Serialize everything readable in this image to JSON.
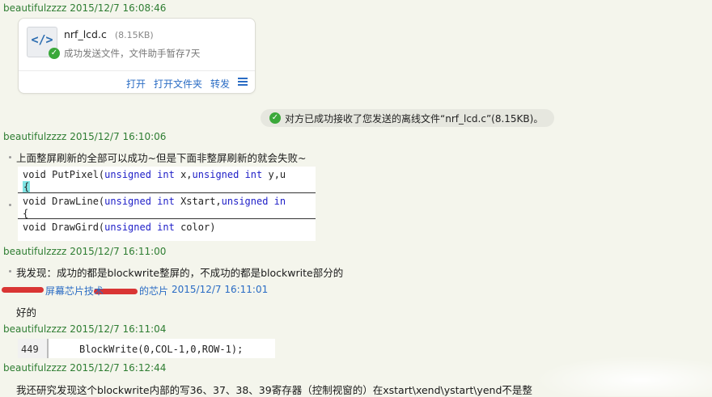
{
  "messages": {
    "m1": {
      "sender": "beautifulzzzz",
      "time": "2015/12/7 16:08:46"
    },
    "m2": {
      "sender": "beautifulzzzz",
      "time": "2015/12/7 16:10:06",
      "text": "上面整屏刷新的全部可以成功~但是下面非整屏刷新的就会失败~"
    },
    "m3": {
      "sender": "beautifulzzzz",
      "time": "2015/12/7 16:11:00",
      "text": "我发现：成功的都是blockwrite整屏的，不成功的都是blockwrite部分的"
    },
    "m4": {
      "sender_partial": "屏幕芯片技术",
      "sender_partial2": "的芯片",
      "time": "2015/12/7 16:11:01",
      "text": "好的"
    },
    "m5": {
      "sender": "beautifulzzzz",
      "time": "2015/12/7 16:11:04"
    },
    "m6": {
      "sender": "beautifulzzzz",
      "time": "2015/12/7 16:12:44",
      "text": "我还研究发现这个blockwrite内部的写36、37、38、39寄存器（控制视窗的）在xstart\\xend\\ystart\\yend不是整"
    }
  },
  "file_card": {
    "filename": "nrf_lcd.c",
    "size": "(8.15KB)",
    "status": "成功发送文件，文件助手暂存7天",
    "actions": {
      "open": "打开",
      "open_folder": "打开文件夹",
      "forward": "转发"
    }
  },
  "notice": {
    "text": "对方已成功接收了您发送的离线文件“nrf_lcd.c”(8.15KB)。"
  },
  "code1": {
    "line1_a": "void PutPixel(",
    "line1_kw1": "unsigned int",
    "line1_b": " x,",
    "line1_kw2": "unsigned int",
    "line1_c": " y,u",
    "line2": "{",
    "line3_a": "void DrawLine(",
    "line3_kw1": "unsigned int",
    "line3_b": " Xstart,",
    "line3_kw2": "unsigned in",
    "line4": "{",
    "line5_a": "void DrawGird(",
    "line5_kw1": "unsigned int",
    "line5_b": " color)"
  },
  "code2": {
    "line_no": "449",
    "code": "BlockWrite(0,COL-1,0,ROW-1);"
  },
  "colors": {
    "sender": "#2e7d32",
    "link": "#2a6cc4",
    "check": "#3aa83a",
    "keyword": "#2020c8"
  },
  "icons": {
    "file": "code-file-icon",
    "success": "check-circle-icon",
    "menu": "menu-icon"
  }
}
